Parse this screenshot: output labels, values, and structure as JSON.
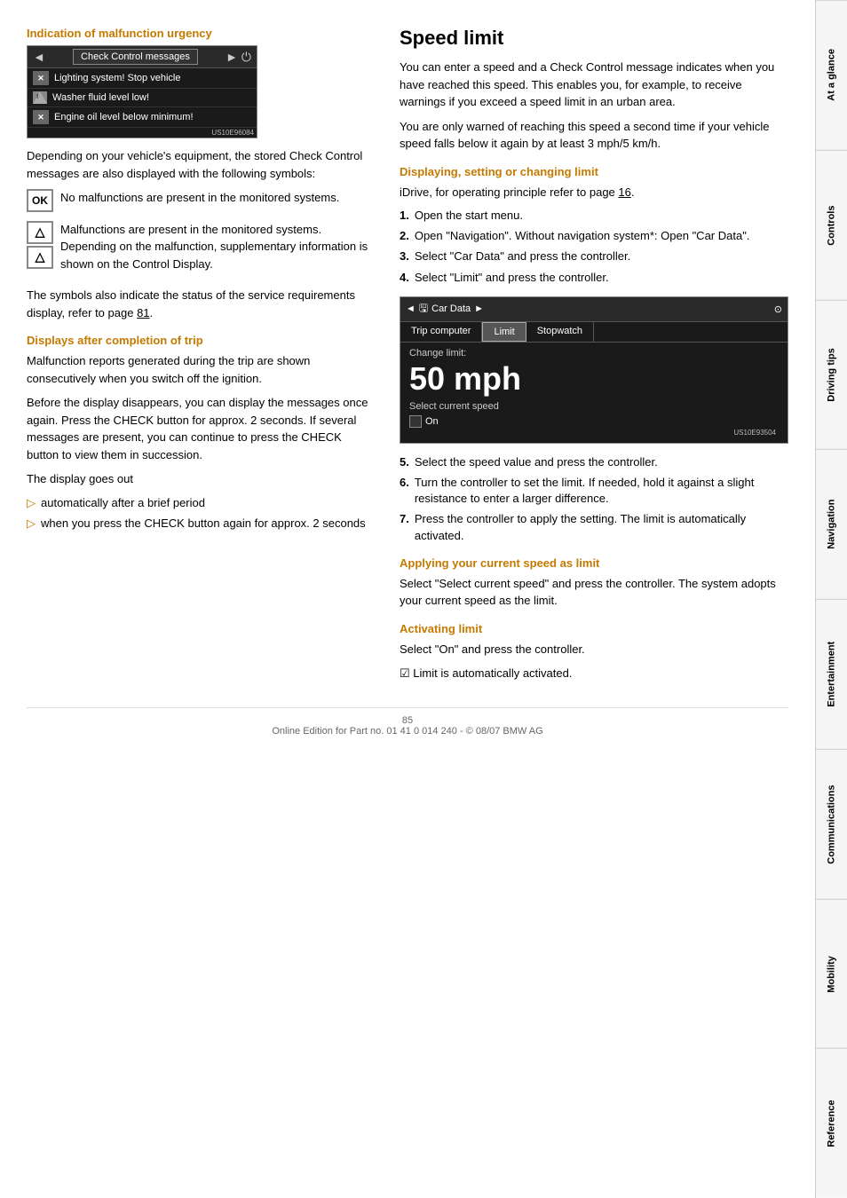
{
  "page": {
    "number": "85",
    "footer": "Online Edition for Part no. 01 41 0 014 240 - © 08/07 BMW AG"
  },
  "side_tabs": [
    {
      "label": "At a glance",
      "active": false
    },
    {
      "label": "Controls",
      "active": false
    },
    {
      "label": "Driving tips",
      "active": false
    },
    {
      "label": "Navigation",
      "active": false
    },
    {
      "label": "Entertainment",
      "active": false
    },
    {
      "label": "Communications",
      "active": false
    },
    {
      "label": "Mobility",
      "active": false
    },
    {
      "label": "Reference",
      "active": false
    }
  ],
  "left_section": {
    "malfunction_header": "Indication of malfunction urgency",
    "check_control": {
      "header_label": "Check Control messages",
      "items": [
        {
          "text": "Lighting system! Stop vehicle",
          "icon": "warning-x"
        },
        {
          "text": "Washer fluid level low!",
          "icon": "warning-triangle"
        },
        {
          "text": "Engine oil level below minimum!",
          "icon": "warning-x"
        }
      ]
    },
    "body_text": "Depending on your vehicle's equipment, the stored Check Control messages are also displayed with the following symbols:",
    "symbols": [
      {
        "symbol": "OK",
        "text": "No malfunctions are present in the monitored systems."
      },
      {
        "symbol": "▲",
        "text": "Malfunctions are present in the monitored systems. Depending on the malfunction, supplementary information is shown on the Control Display."
      }
    ],
    "symbols_note": "The symbols also indicate the status of the service requirements display, refer to page 81.",
    "displays_after_header": "Displays after completion of trip",
    "displays_after_text1": "Malfunction reports generated during the trip are shown consecutively when you switch off the ignition.",
    "displays_after_text2": "Before the display disappears, you can display the messages once again. Press the CHECK button for approx. 2 seconds. If several messages are present, you can continue to press the CHECK button to view them in succession.",
    "display_goes_out": "The display goes out",
    "bullets": [
      "automatically after a brief period",
      "when you press the CHECK button again for approx. 2 seconds"
    ]
  },
  "right_section": {
    "main_title": "Speed limit",
    "intro_text": "You can enter a speed and a Check Control message indicates when you have reached this speed. This enables you, for example, to receive warnings if you exceed a speed limit in an urban area.",
    "intro_text2": "You are only warned of reaching this speed a second time if your vehicle speed falls below it again by at least 3 mph/5 km/h.",
    "displaying_header": "Displaying, setting or changing limit",
    "idrive_ref": "iDrive, for operating principle refer to page 16.",
    "steps": [
      "Open the start menu.",
      "Open \"Navigation\". Without navigation system*: Open \"Car Data\".",
      "Select \"Car Data\" and press the controller.",
      "Select \"Limit\" and press the controller."
    ],
    "idrive_display": {
      "header_nav": "Car Data",
      "tabs": [
        {
          "label": "Trip computer",
          "active": false
        },
        {
          "label": "Limit",
          "active": true
        },
        {
          "label": "Stopwatch",
          "active": false
        }
      ],
      "change_limit_label": "Change limit:",
      "speed_value": "50 mph",
      "select_speed_label": "Select current speed",
      "on_label": "On"
    },
    "steps_continued": [
      "Select the speed value and press the controller.",
      "Turn the controller to set the limit. If needed, hold it against a slight resistance to enter a larger difference.",
      "Press the controller to apply the setting. The limit is automatically activated."
    ],
    "applying_header": "Applying your current speed as limit",
    "applying_text": "Select \"Select current speed\" and press the controller. The system adopts your current speed as the limit.",
    "activating_header": "Activating limit",
    "activating_text1": "Select \"On\" and press the controller.",
    "activating_text2": "Limit is automatically activated."
  }
}
